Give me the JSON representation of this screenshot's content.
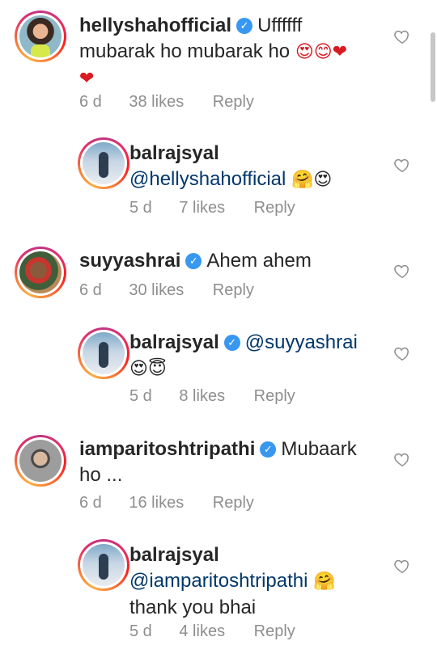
{
  "comments": [
    {
      "username": "hellyshahofficial",
      "verified": true,
      "text_line1": "Uffffff",
      "text_line2": "mubarak ho mubarak ho",
      "emoji_line2": "😍😊❤",
      "emoji_line3": "❤",
      "age": "6 d",
      "likes": "38 likes",
      "reply": "Reply",
      "avatar": "helly-avatar"
    },
    {
      "username": "balrajsyal",
      "verified": false,
      "mention": "@hellyshahofficial",
      "emoji": "🤗😍",
      "age": "5 d",
      "likes": "7 likes",
      "reply": "Reply",
      "avatar": "balraj-avatar"
    },
    {
      "username": "suyyashrai",
      "verified": true,
      "text": "Ahem ahem",
      "age": "6 d",
      "likes": "30 likes",
      "reply": "Reply",
      "avatar": "suyyash-avatar"
    },
    {
      "username": "balrajsyal",
      "verified": true,
      "mention": "@suyyashrai",
      "emoji": "😍😇",
      "age": "5 d",
      "likes": "8 likes",
      "reply": "Reply",
      "avatar": "balraj-avatar"
    },
    {
      "username": "iamparitoshtripathi",
      "verified": true,
      "text_line1": "Mubaark",
      "text_line2": "ho ...",
      "age": "6 d",
      "likes": "16 likes",
      "reply": "Reply",
      "avatar": "paritosh-avatar"
    },
    {
      "username": "balrajsyal",
      "verified": false,
      "mention": "@iamparitoshtripathi",
      "emoji": "🤗",
      "text_line2": "thank you bhai",
      "age": "5 d",
      "likes": "4 likes",
      "reply": "Reply",
      "avatar": "balraj-avatar"
    }
  ],
  "colors": {
    "text": "#262626",
    "meta": "#8e8e8e",
    "mention": "#00376b",
    "verified": "#3897f0"
  },
  "icons": {
    "like": "heart-outline-icon",
    "verified": "verified-badge-icon"
  }
}
